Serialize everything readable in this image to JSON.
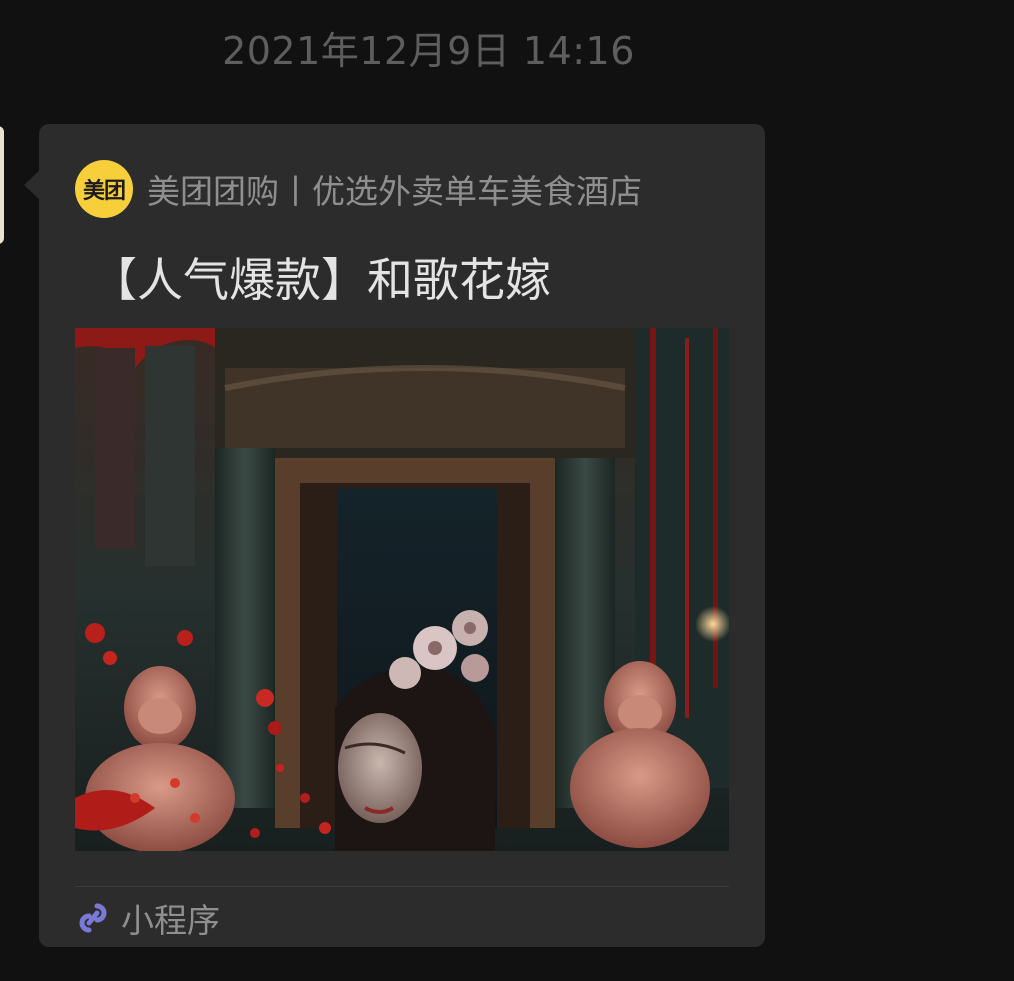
{
  "chat": {
    "timestamp": "2021年12月9日 14:16"
  },
  "card": {
    "app_logo_text": "美团",
    "app_name": "美团团购丨优选外卖单车美食酒店",
    "title": "【人气爆款】和歌花嫁",
    "footer_label": "小程序",
    "footer_icon": "mini-program-icon",
    "colors": {
      "bubble": "#2c2c2c",
      "logo": "#f7cf3a",
      "mini_program_icon": "#7a79d6"
    }
  }
}
